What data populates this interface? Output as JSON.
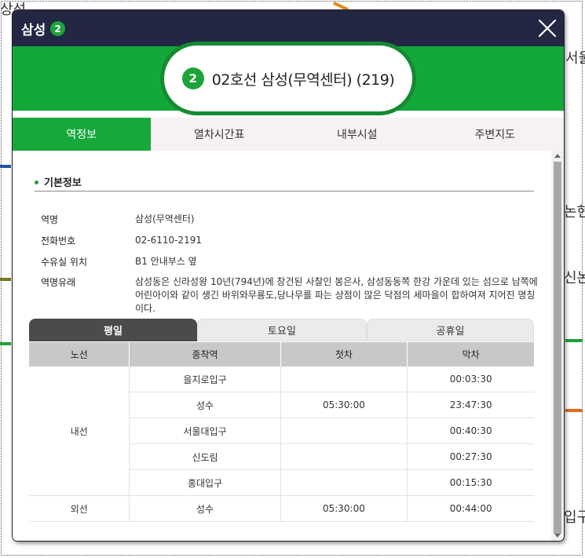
{
  "background": {
    "fragments": [
      "상성",
      "서울",
      "논현",
      "신논",
      "입구"
    ]
  },
  "modal": {
    "title": "삼성",
    "line_number": "2",
    "close_icon": "close-icon",
    "station_full": "02호선 삼성(무역센터) (219)",
    "tabs": [
      "역정보",
      "열차시간표",
      "내부시설",
      "주변지도"
    ],
    "active_tab": "역정보"
  },
  "basic_info": {
    "title": "기본정보",
    "rows": [
      {
        "label": "역명",
        "value": "삼성(무역센터)"
      },
      {
        "label": "전화번호",
        "value": "02-6110-2191"
      },
      {
        "label": "수유실 위치",
        "value": "B1 안내부스 옆"
      },
      {
        "label": "역명유래",
        "value": "삼성동은 신라성왕 10년(794년)에 창건된 사찰인 봉은사, 삼성동동쪽 한강 가운데 있는 섬으로 남쪽에 어린아이와 같이 생긴 바위와무룡도,당나무를 파는 상점이 많은 닥점의 세마을이 합하여져 지어진 명칭이다."
      }
    ]
  },
  "timetable": {
    "day_tabs": [
      "평일",
      "토요일",
      "공휴일"
    ],
    "active_day": "평일",
    "headers": [
      "노선",
      "종착역",
      "첫차",
      "막차"
    ],
    "groups": [
      {
        "line": "내선",
        "rows": [
          {
            "terminal": "을지로입구",
            "first": "",
            "last": "00:03:30"
          },
          {
            "terminal": "성수",
            "first": "05:30:00",
            "last": "23:47:30"
          },
          {
            "terminal": "서울대입구",
            "first": "",
            "last": "00:40:30"
          },
          {
            "terminal": "신도림",
            "first": "",
            "last": "00:27:30"
          },
          {
            "terminal": "홍대입구",
            "first": "",
            "last": "00:15:30"
          }
        ]
      },
      {
        "line": "외선",
        "rows": [
          {
            "terminal": "성수",
            "first": "05:30:00",
            "last": "00:44:00"
          }
        ]
      }
    ]
  },
  "colors": {
    "header_bg": "#232743",
    "line2_green": "#1ca33a",
    "active_day_tab": "#4b4b4b"
  }
}
